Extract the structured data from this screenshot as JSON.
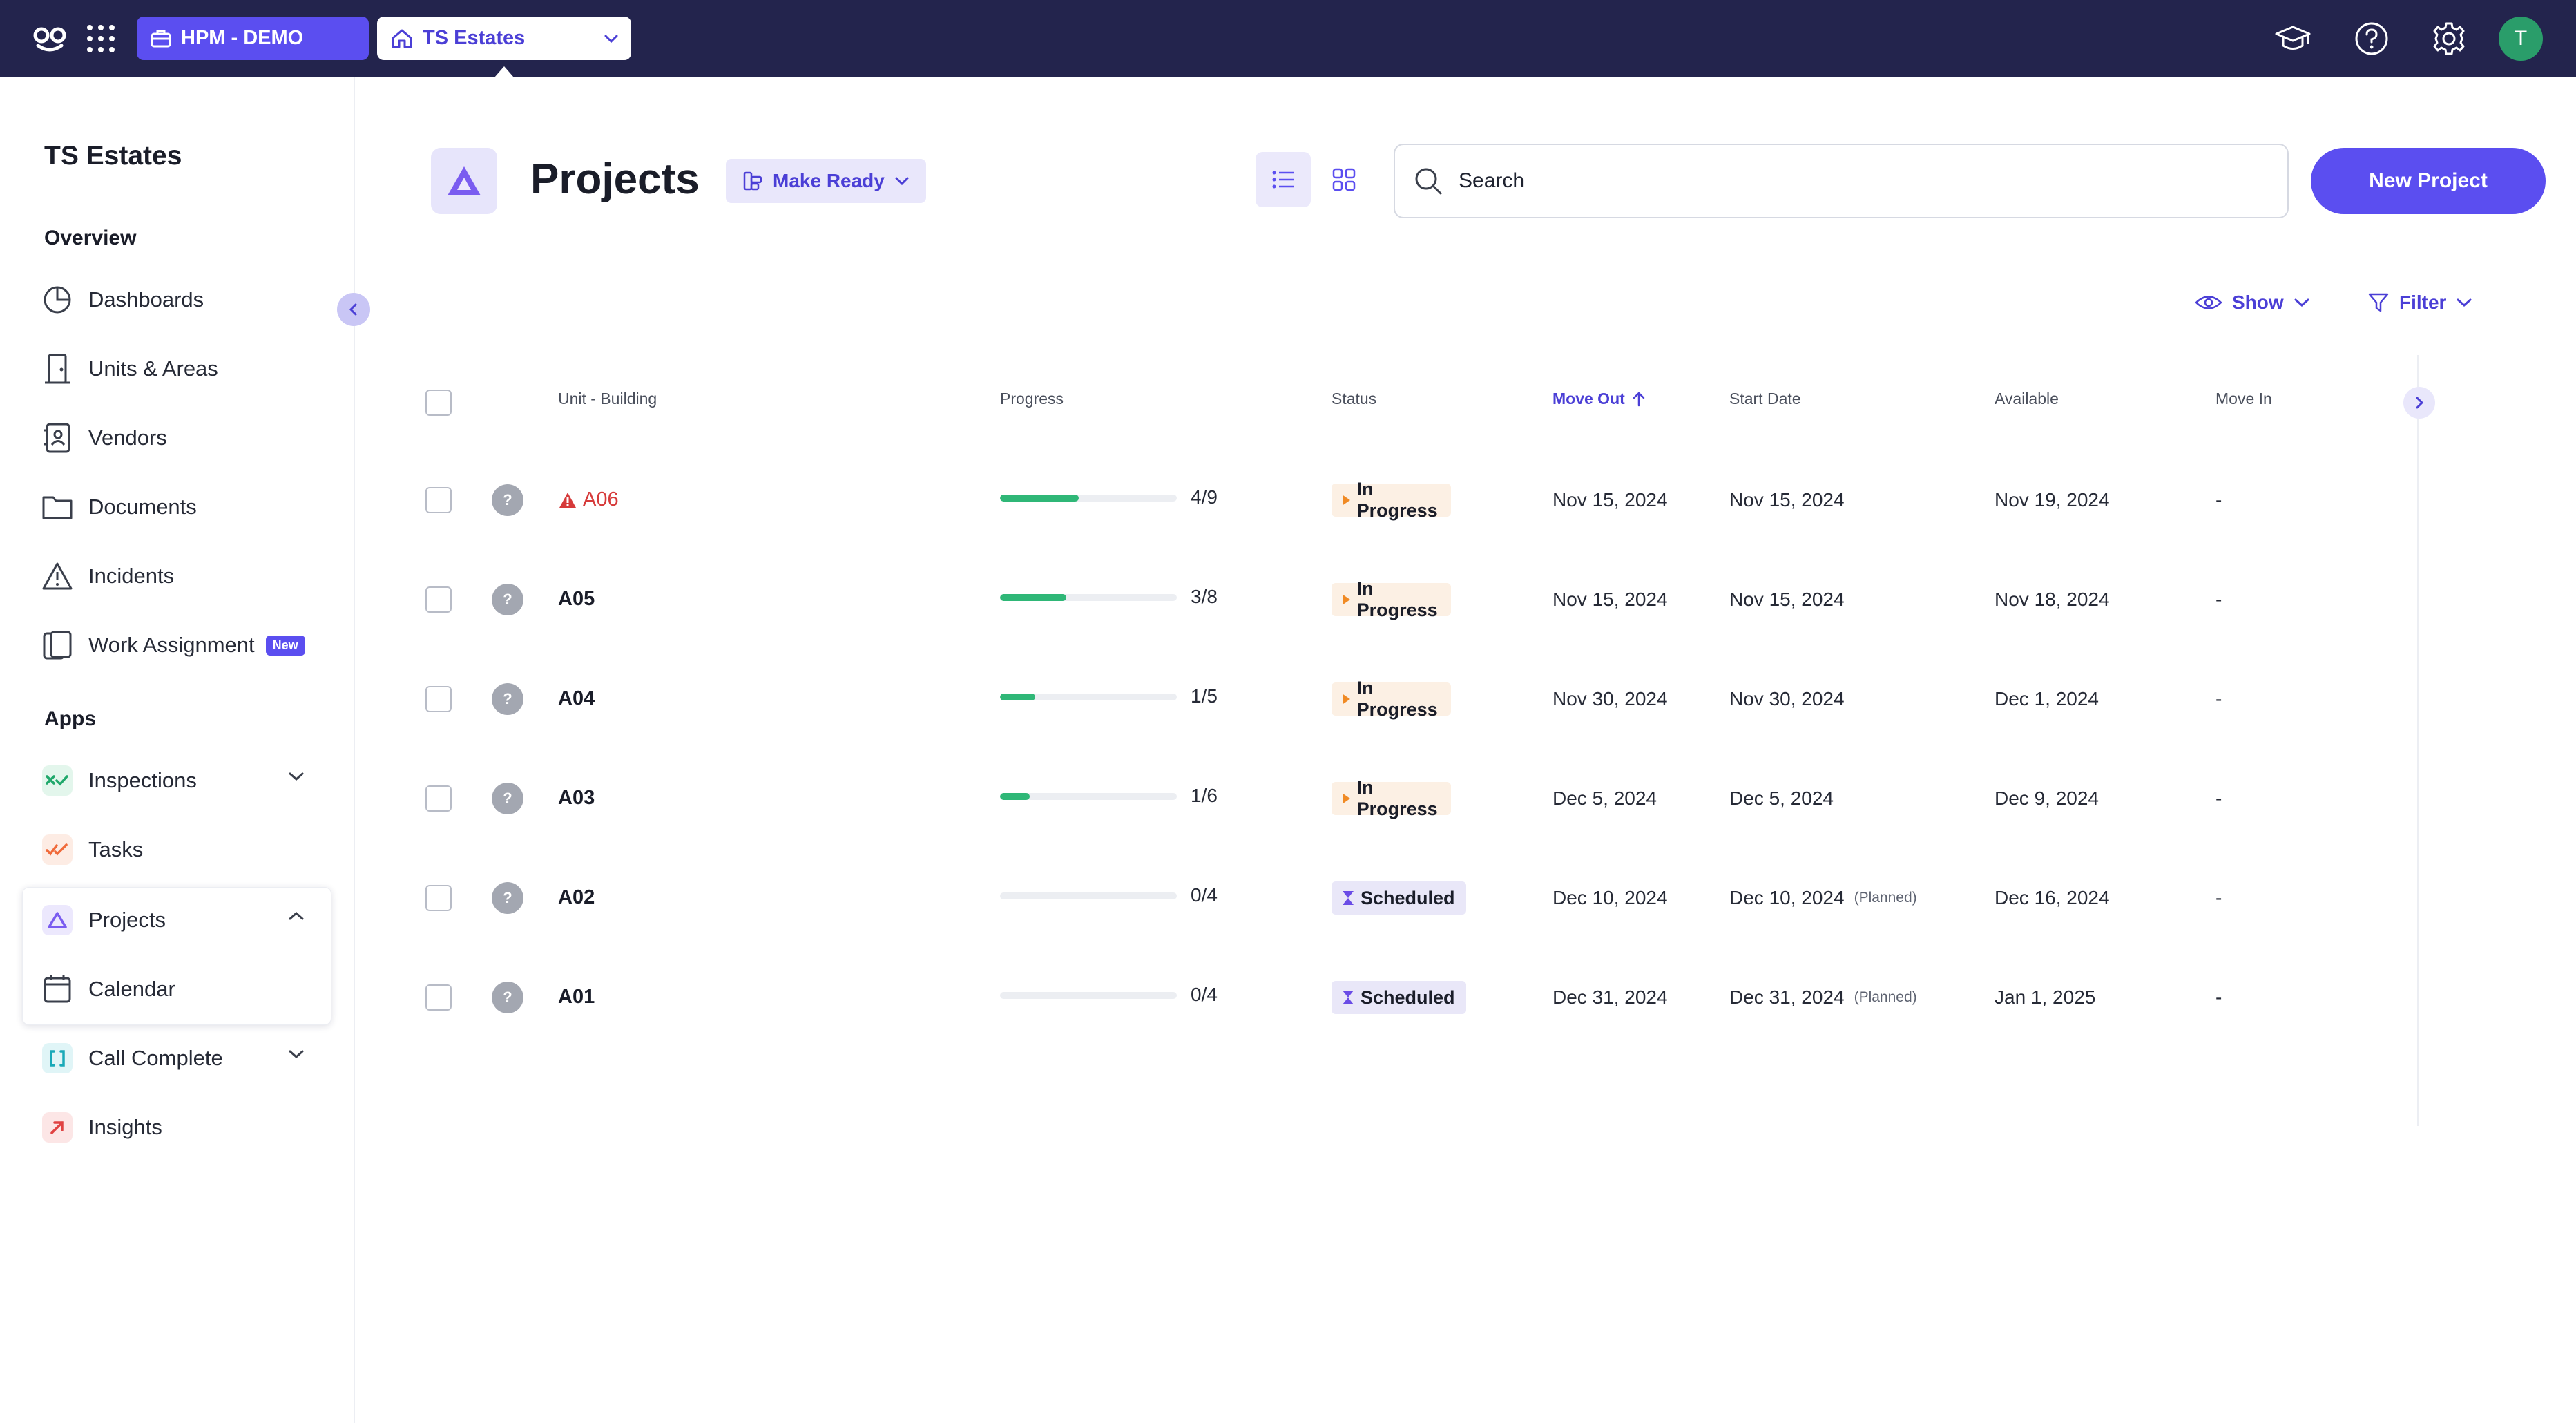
{
  "topbar": {
    "org_label": "HPM - DEMO",
    "property_label": "TS Estates",
    "icons": [
      "logo-icon",
      "app-grid-icon",
      "graduation-cap-icon",
      "help-icon",
      "settings-gear-icon"
    ],
    "avatar_initial": "T"
  },
  "sidebar": {
    "title": "TS Estates",
    "overview_heading": "Overview",
    "overview_items": [
      {
        "label": "Dashboards",
        "icon": "pie-chart-icon"
      },
      {
        "label": "Units & Areas",
        "icon": "door-icon"
      },
      {
        "label": "Vendors",
        "icon": "contact-book-icon"
      },
      {
        "label": "Documents",
        "icon": "folder-icon"
      },
      {
        "label": "Incidents",
        "icon": "warning-icon"
      },
      {
        "label": "Work Assignment",
        "icon": "clipboard-icon",
        "badge": "New"
      }
    ],
    "apps_heading": "Apps",
    "app_items": [
      {
        "label": "Inspections",
        "icon": "inspections-icon",
        "color": "#20a86b"
      },
      {
        "label": "Tasks",
        "icon": "tasks-icon",
        "color": "#f06a3a"
      },
      {
        "label": "Projects",
        "icon": "projects-icon",
        "color": "#7a5cf0"
      },
      {
        "label": "Calendar",
        "icon": "calendar-icon"
      },
      {
        "label": "Call Complete",
        "icon": "call-complete-icon",
        "color": "#19a9b8"
      },
      {
        "label": "Insights",
        "icon": "insights-icon",
        "color": "#e04343"
      }
    ]
  },
  "main": {
    "title": "Projects",
    "template_label": "Make Ready",
    "search_placeholder": "Search",
    "new_button": "New Project",
    "show_label": "Show",
    "filter_label": "Filter"
  },
  "table": {
    "columns": [
      "Unit - Building",
      "Progress",
      "Status",
      "Move Out",
      "Start Date",
      "Available",
      "Move In"
    ],
    "sorted_column": "Move Out",
    "rows": [
      {
        "unit": "A06",
        "alert": true,
        "progress_text": "4/9",
        "progress": 0.444,
        "status": "In Progress",
        "move_out": "Nov 15, 2024",
        "start_date": "Nov 15, 2024",
        "planned": "",
        "available": "Nov 19, 2024",
        "move_in": "-"
      },
      {
        "unit": "A05",
        "alert": false,
        "progress_text": "3/8",
        "progress": 0.375,
        "status": "In Progress",
        "move_out": "Nov 15, 2024",
        "start_date": "Nov 15, 2024",
        "planned": "",
        "available": "Nov 18, 2024",
        "move_in": "-"
      },
      {
        "unit": "A04",
        "alert": false,
        "progress_text": "1/5",
        "progress": 0.2,
        "status": "In Progress",
        "move_out": "Nov 30, 2024",
        "start_date": "Nov 30, 2024",
        "planned": "",
        "available": "Dec 1, 2024",
        "move_in": "-"
      },
      {
        "unit": "A03",
        "alert": false,
        "progress_text": "1/6",
        "progress": 0.167,
        "status": "In Progress",
        "move_out": "Dec 5, 2024",
        "start_date": "Dec 5, 2024",
        "planned": "",
        "available": "Dec 9, 2024",
        "move_in": "-"
      },
      {
        "unit": "A02",
        "alert": false,
        "progress_text": "0/4",
        "progress": 0,
        "status": "Scheduled",
        "move_out": "Dec 10, 2024",
        "start_date": "Dec 10, 2024",
        "planned": "(Planned)",
        "available": "Dec 16, 2024",
        "move_in": "-"
      },
      {
        "unit": "A01",
        "alert": false,
        "progress_text": "0/4",
        "progress": 0,
        "status": "Scheduled",
        "move_out": "Dec 31, 2024",
        "start_date": "Dec 31, 2024",
        "planned": "(Planned)",
        "available": "Jan 1, 2025",
        "move_in": "-"
      }
    ]
  },
  "colors": {
    "topbar_bg": "#23244d",
    "accent": "#5b4ef0",
    "progress_fill": "#2fb777",
    "in_progress_bg": "#fcf0e4",
    "in_progress_icon": "#f08a24",
    "scheduled_bg": "#e9e7f8",
    "scheduled_icon": "#6a4ce6",
    "alert": "#d63a3a"
  }
}
